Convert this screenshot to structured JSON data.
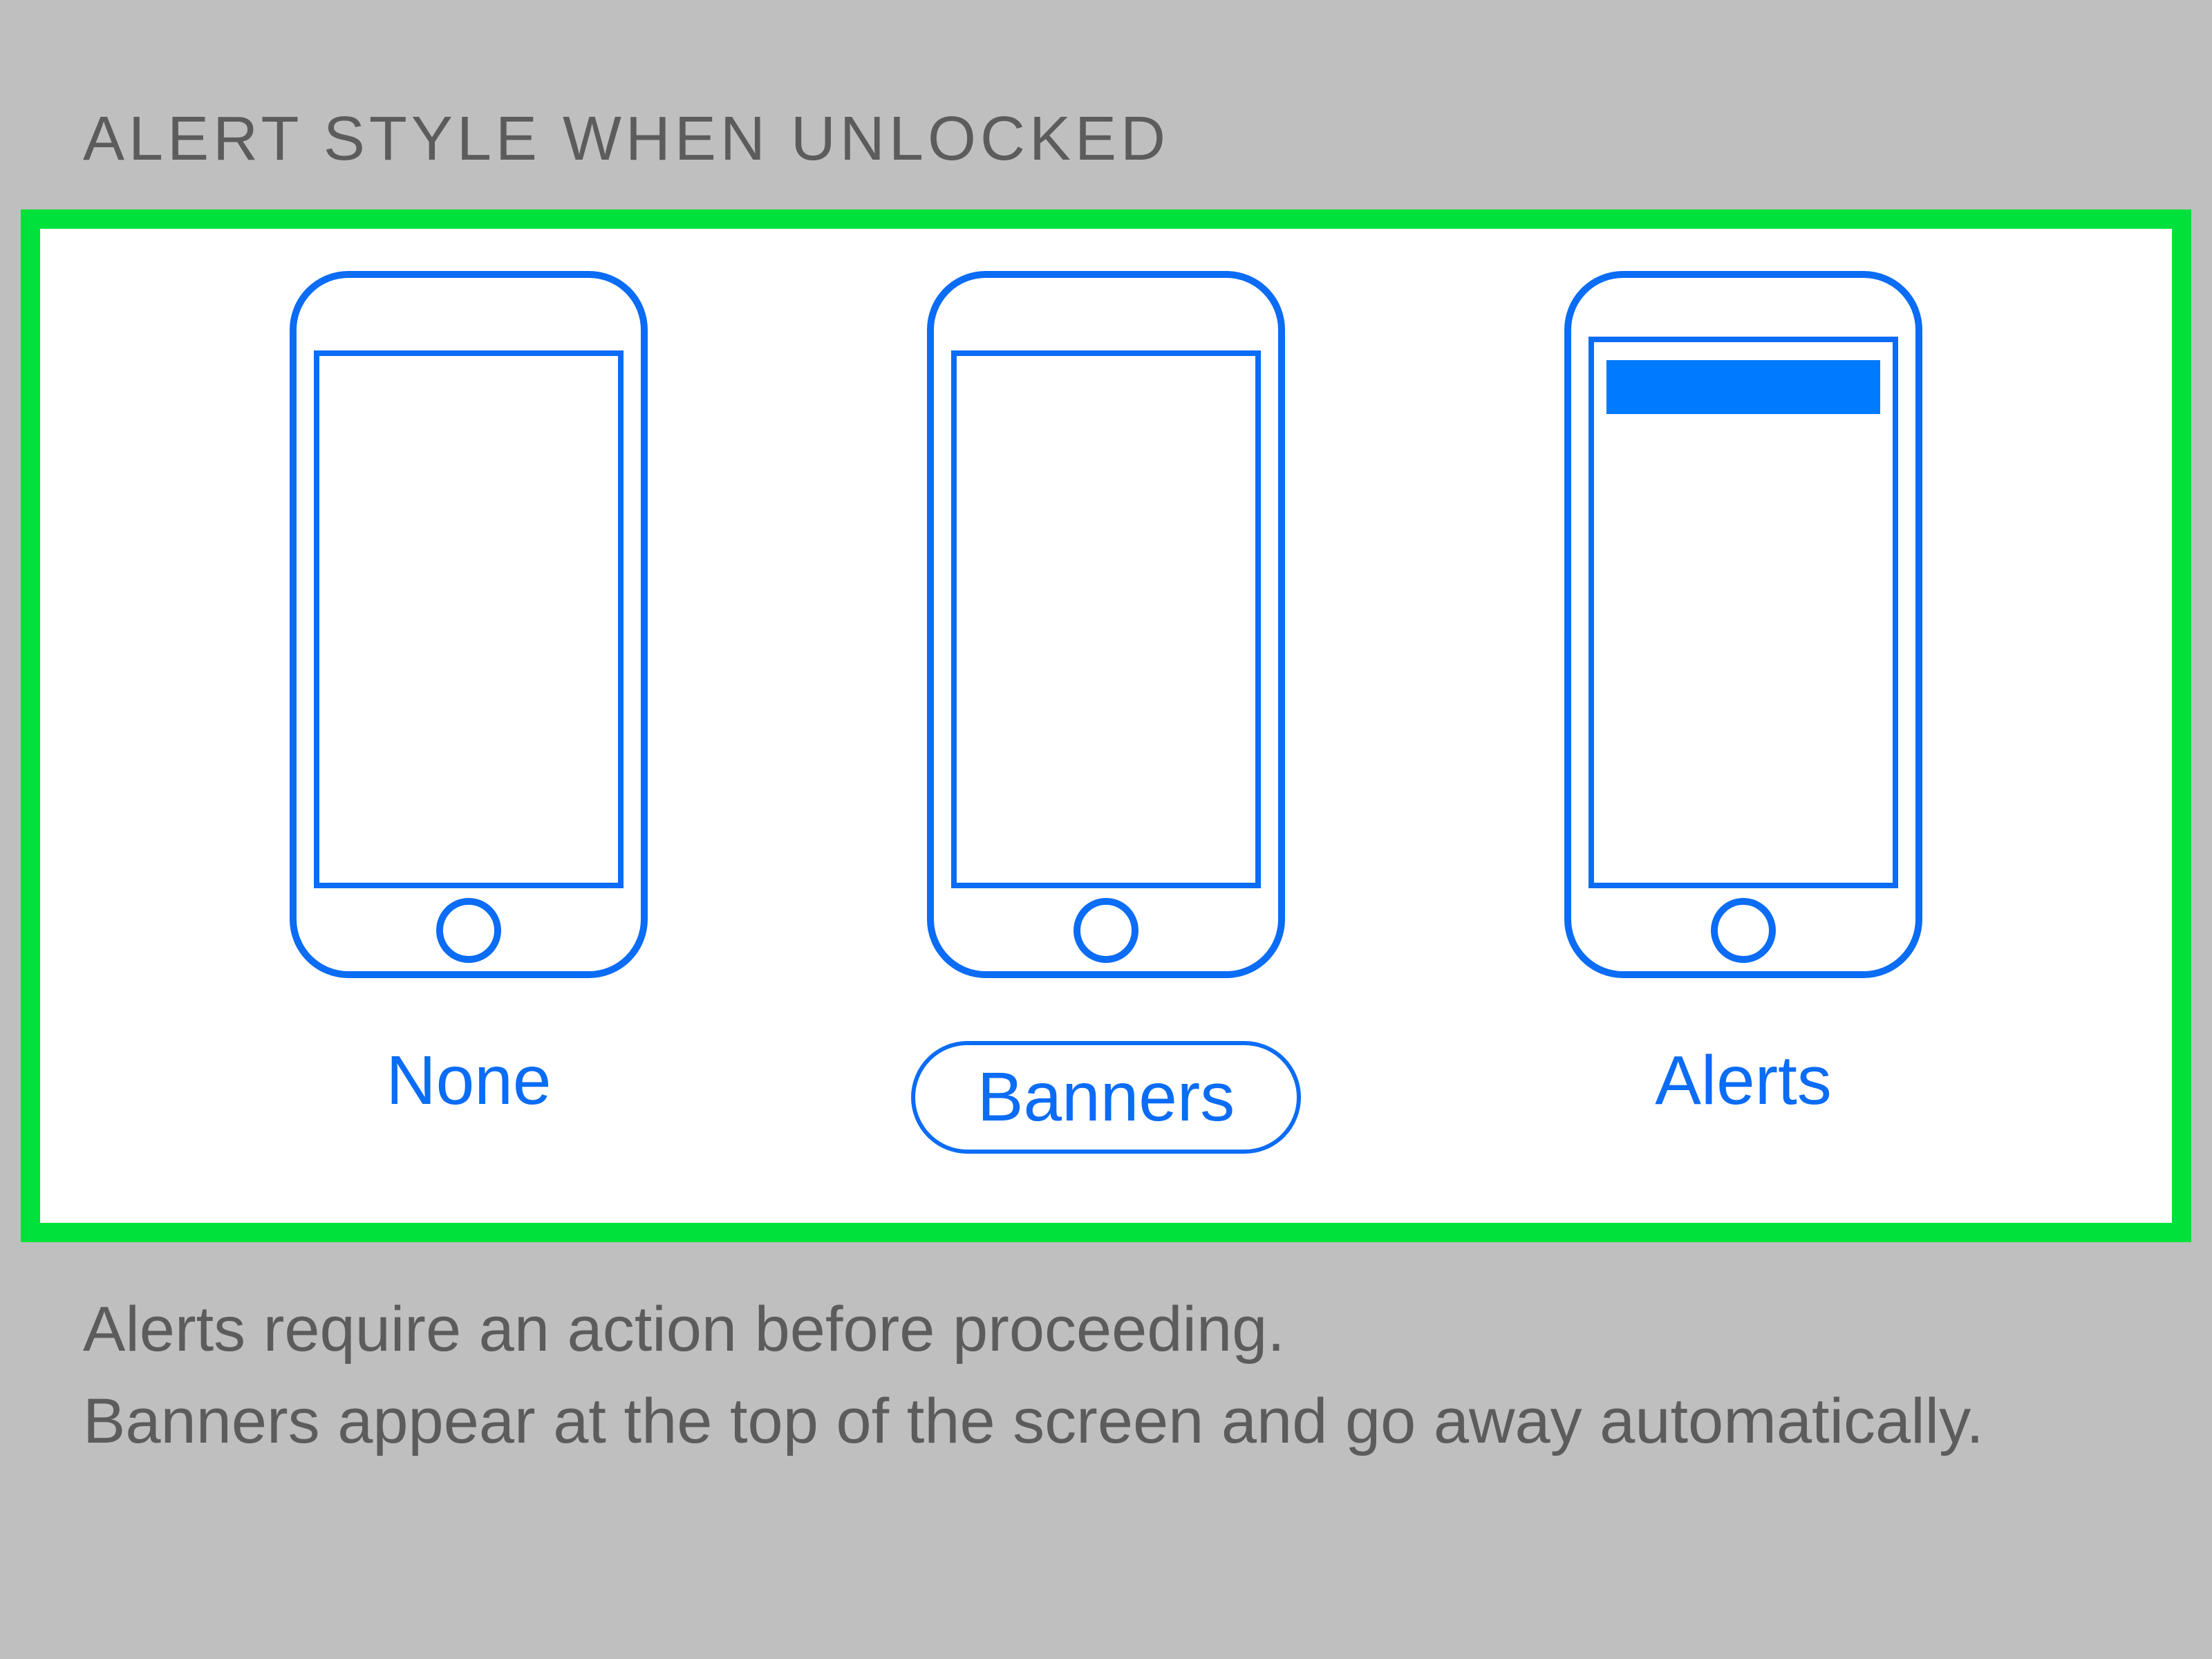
{
  "section": {
    "header": "ALERT STYLE WHEN UNLOCKED"
  },
  "options": {
    "none": {
      "label": "None"
    },
    "banners": {
      "label": "Banners"
    },
    "alerts": {
      "label": "Alerts"
    }
  },
  "footer": {
    "line1": "Alerts require an action before proceeding.",
    "line2": "Banners appear at the top of the screen and go away automatically."
  },
  "colors": {
    "accent": "#0b6cf5",
    "highlight_border": "#00e23b",
    "page_bg": "#bfbfbf",
    "text_secondary": "#5c5c5c"
  }
}
